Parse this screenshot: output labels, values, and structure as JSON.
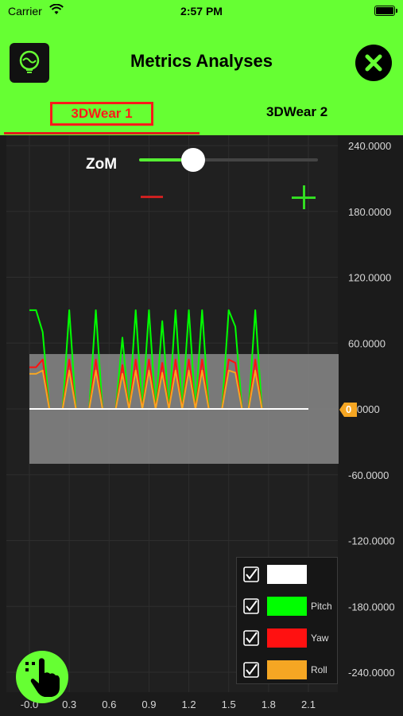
{
  "status_bar": {
    "carrier": "Carrier",
    "time": "2:57 PM"
  },
  "header": {
    "title": "Metrics Analyses"
  },
  "tabs": [
    {
      "label": "3DWear 1",
      "selected": true
    },
    {
      "label": "3DWear 2",
      "selected": false
    }
  ],
  "controls": {
    "zoom_label": "ZoM",
    "zoom_level": 0.3
  },
  "marker": {
    "value": "0"
  },
  "legend": [
    {
      "label": "",
      "color": "#ffffff",
      "checked": true
    },
    {
      "label": "Pitch",
      "color": "#00ff00",
      "checked": true
    },
    {
      "label": "Yaw",
      "color": "#ff1111",
      "checked": true
    },
    {
      "label": "Roll",
      "color": "#f5a623",
      "checked": true
    }
  ],
  "colors": {
    "accent": "#66ff33",
    "tab_highlight": "#ff1a1a",
    "background": "#1b1b1b"
  },
  "chart_data": {
    "type": "line",
    "xlim": [
      -0.05,
      2.35
    ],
    "ylim": [
      -260,
      260
    ],
    "x_ticks": [
      "-0.0",
      "0.3",
      "0.6",
      "0.9",
      "1.2",
      "1.5",
      "1.8",
      "2.1"
    ],
    "y_ticks": [
      "240.0000",
      "180.0000",
      "120.0000",
      "60.0000",
      "0.0000",
      "-60.0000",
      "-120.0000",
      "-180.0000",
      "-240.0000"
    ],
    "band": {
      "y_from": -50,
      "y_to": 50
    },
    "peaks_x": [
      0.3,
      0.5,
      0.72,
      0.88,
      1.04,
      1.1,
      1.17,
      1.3,
      1.51,
      1.7
    ],
    "peaks_x_minor": [
      0.66,
      0.98,
      1.22
    ],
    "series": [
      {
        "name": "",
        "color": "#ffffff",
        "x": [
          0,
          2.1
        ],
        "y": [
          0,
          0
        ]
      },
      {
        "name": "Pitch",
        "color": "#00ff00",
        "x": [
          0,
          0.05,
          0.1,
          0.15,
          0.25,
          0.3,
          0.35,
          0.45,
          0.5,
          0.55,
          0.65,
          0.7,
          0.75,
          0.8,
          0.85,
          0.9,
          0.95,
          1.0,
          1.05,
          1.1,
          1.15,
          1.2,
          1.25,
          1.3,
          1.35,
          1.45,
          1.5,
          1.55,
          1.6,
          1.65,
          1.7,
          1.75,
          2.1
        ],
        "y": [
          90,
          90,
          70,
          0,
          0,
          90,
          0,
          0,
          90,
          0,
          0,
          65,
          0,
          90,
          0,
          90,
          0,
          80,
          0,
          90,
          0,
          90,
          0,
          90,
          0,
          0,
          90,
          75,
          0,
          0,
          90,
          0,
          0
        ]
      },
      {
        "name": "Yaw",
        "color": "#ff1111",
        "x": [
          0,
          0.05,
          0.1,
          0.15,
          0.25,
          0.3,
          0.35,
          0.45,
          0.5,
          0.55,
          0.65,
          0.7,
          0.75,
          0.8,
          0.85,
          0.9,
          0.95,
          1.0,
          1.05,
          1.1,
          1.15,
          1.2,
          1.25,
          1.3,
          1.35,
          1.45,
          1.5,
          1.55,
          1.6,
          1.65,
          1.7,
          1.75,
          2.1
        ],
        "y": [
          38,
          38,
          45,
          0,
          0,
          45,
          0,
          0,
          45,
          0,
          0,
          40,
          0,
          45,
          0,
          45,
          0,
          42,
          0,
          45,
          0,
          45,
          0,
          45,
          0,
          0,
          45,
          42,
          0,
          0,
          45,
          0,
          0
        ]
      },
      {
        "name": "Roll",
        "color": "#f5a623",
        "x": [
          0,
          0.05,
          0.1,
          0.15,
          0.25,
          0.3,
          0.35,
          0.45,
          0.5,
          0.55,
          0.65,
          0.7,
          0.75,
          0.8,
          0.85,
          0.9,
          0.95,
          1.0,
          1.05,
          1.1,
          1.15,
          1.2,
          1.25,
          1.3,
          1.35,
          1.45,
          1.5,
          1.55,
          1.6,
          1.65,
          1.7,
          1.75,
          2.1
        ],
        "y": [
          32,
          32,
          35,
          0,
          0,
          35,
          0,
          0,
          35,
          0,
          0,
          32,
          0,
          35,
          0,
          35,
          0,
          33,
          0,
          35,
          0,
          35,
          0,
          35,
          0,
          0,
          35,
          33,
          0,
          0,
          35,
          0,
          0
        ]
      }
    ]
  }
}
